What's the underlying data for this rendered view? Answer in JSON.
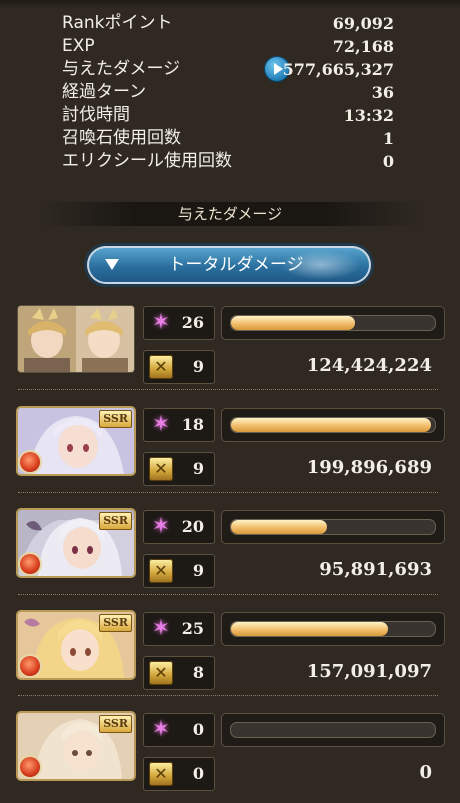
{
  "result_stats": [
    {
      "label": "Rankポイント",
      "value": "69,092"
    },
    {
      "label": "EXP",
      "value": "72,168"
    },
    {
      "label": "与えたダメージ",
      "value": "577,665,327",
      "icon": "play-icon"
    },
    {
      "label": "経過ターン",
      "value": "36"
    },
    {
      "label": "討伐時間",
      "value": "13:32"
    },
    {
      "label": "召喚石使用回数",
      "value": "1"
    },
    {
      "label": "エリクシール使用回数",
      "value": "0"
    }
  ],
  "section": {
    "title": "与えたダメージ"
  },
  "dropdown": {
    "label": "トータルダメージ"
  },
  "colors": {
    "accent_blue": "#2a6f9e",
    "bar_gold": "#f3c273",
    "fire_element": "#d63b1c",
    "skill_pink": "#e680e6"
  },
  "characters": [
    {
      "name": "portrait-1",
      "ssr": false,
      "element": false,
      "skills": "26",
      "chain": "9",
      "bar_fraction": 0.61,
      "damage": "124,424,224"
    },
    {
      "name": "portrait-2",
      "ssr": true,
      "element": true,
      "skills": "18",
      "chain": "9",
      "bar_fraction": 0.98,
      "damage": "199,896,689"
    },
    {
      "name": "portrait-3",
      "ssr": true,
      "element": true,
      "skills": "20",
      "chain": "9",
      "bar_fraction": 0.47,
      "damage": "95,891,693"
    },
    {
      "name": "portrait-4",
      "ssr": true,
      "element": true,
      "skills": "25",
      "chain": "8",
      "bar_fraction": 0.77,
      "damage": "157,091,097"
    },
    {
      "name": "portrait-5",
      "ssr": true,
      "element": true,
      "skills": "0",
      "chain": "0",
      "bar_fraction": 0.0,
      "damage": "0"
    }
  ],
  "badge_text": "SSR"
}
